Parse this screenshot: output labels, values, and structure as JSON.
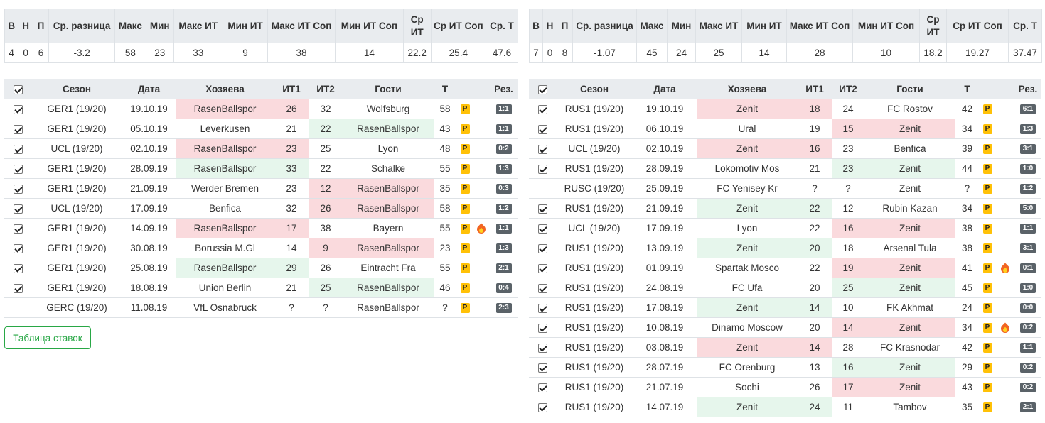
{
  "left": {
    "stats": {
      "headers": [
        "В",
        "Н",
        "П",
        "Ср. разница",
        "Макс",
        "Мин",
        "Макс ИТ",
        "Мин ИТ",
        "Макс ИТ Соп",
        "Мин ИТ Соп",
        "Ср ИТ",
        "Ср ИТ Соп",
        "Ср. Т"
      ],
      "values": [
        "4",
        "0",
        "6",
        "-3.2",
        "58",
        "23",
        "33",
        "9",
        "38",
        "14",
        "22.2",
        "25.4",
        "47.6"
      ]
    },
    "games": {
      "headers": [
        "Сезон",
        "Дата",
        "Хозяева",
        "ИТ1",
        "ИТ2",
        "Гости",
        "Т",
        "Рез."
      ],
      "rows": [
        {
          "checked": true,
          "season": "GER1 (19/20)",
          "date": "19.10.19",
          "home": "RasenBallspor",
          "it1": "26",
          "it2": "32",
          "away": "Wolfsburg",
          "t": "58",
          "fire": false,
          "res": "1:1",
          "hl": "home-lose"
        },
        {
          "checked": true,
          "season": "GER1 (19/20)",
          "date": "05.10.19",
          "home": "Leverkusen",
          "it1": "21",
          "it2": "22",
          "away": "RasenBallspor",
          "t": "43",
          "fire": false,
          "res": "1:1",
          "hl": "away-win"
        },
        {
          "checked": true,
          "season": "UCL (19/20)",
          "date": "02.10.19",
          "home": "RasenBallspor",
          "it1": "23",
          "it2": "25",
          "away": "Lyon",
          "t": "48",
          "fire": false,
          "res": "0:2",
          "hl": "home-lose"
        },
        {
          "checked": true,
          "season": "GER1 (19/20)",
          "date": "28.09.19",
          "home": "RasenBallspor",
          "it1": "33",
          "it2": "22",
          "away": "Schalke",
          "t": "55",
          "fire": false,
          "res": "1:3",
          "hl": "home-win"
        },
        {
          "checked": true,
          "season": "GER1 (19/20)",
          "date": "21.09.19",
          "home": "Werder Bremen",
          "it1": "23",
          "it2": "12",
          "away": "RasenBallspor",
          "t": "35",
          "fire": false,
          "res": "0:3",
          "hl": "away-lose"
        },
        {
          "checked": true,
          "season": "UCL (19/20)",
          "date": "17.09.19",
          "home": "Benfica",
          "it1": "32",
          "it2": "26",
          "away": "RasenBallspor",
          "t": "58",
          "fire": false,
          "res": "1:2",
          "hl": "away-lose"
        },
        {
          "checked": true,
          "season": "GER1 (19/20)",
          "date": "14.09.19",
          "home": "RasenBallspor",
          "it1": "17",
          "it2": "38",
          "away": "Bayern",
          "t": "55",
          "fire": true,
          "res": "1:1",
          "hl": "home-lose"
        },
        {
          "checked": true,
          "season": "GER1 (19/20)",
          "date": "30.08.19",
          "home": "Borussia M.Gl",
          "it1": "14",
          "it2": "9",
          "away": "RasenBallspor",
          "t": "23",
          "fire": false,
          "res": "1:3",
          "hl": "away-lose"
        },
        {
          "checked": true,
          "season": "GER1 (19/20)",
          "date": "25.08.19",
          "home": "RasenBallspor",
          "it1": "29",
          "it2": "26",
          "away": "Eintracht Fra",
          "t": "55",
          "fire": false,
          "res": "2:1",
          "hl": "home-win"
        },
        {
          "checked": true,
          "season": "GER1 (19/20)",
          "date": "18.08.19",
          "home": "Union Berlin",
          "it1": "21",
          "it2": "25",
          "away": "RasenBallspor",
          "t": "46",
          "fire": false,
          "res": "0:4",
          "hl": "away-win"
        },
        {
          "checked": false,
          "season": "GERC (19/20)",
          "date": "11.08.19",
          "home": "VfL Osnabruck",
          "it1": "?",
          "it2": "?",
          "away": "RasenBallspor",
          "t": "?",
          "fire": false,
          "res": "2:3",
          "hl": "none"
        }
      ]
    }
  },
  "right": {
    "stats": {
      "headers": [
        "В",
        "Н",
        "П",
        "Ср. разница",
        "Макс",
        "Мин",
        "Макс ИТ",
        "Мин ИТ",
        "Макс ИТ Соп",
        "Мин ИТ Соп",
        "Ср ИТ",
        "Ср ИТ Соп",
        "Ср. Т"
      ],
      "values": [
        "7",
        "0",
        "8",
        "-1.07",
        "45",
        "24",
        "25",
        "14",
        "28",
        "10",
        "18.2",
        "19.27",
        "37.47"
      ]
    },
    "games": {
      "headers": [
        "Сезон",
        "Дата",
        "Хозяева",
        "ИТ1",
        "ИТ2",
        "Гости",
        "Т",
        "Рез."
      ],
      "rows": [
        {
          "checked": true,
          "season": "RUS1 (19/20)",
          "date": "19.10.19",
          "home": "Zenit",
          "it1": "18",
          "it2": "24",
          "away": "FC Rostov",
          "t": "42",
          "fire": false,
          "res": "6:1",
          "hl": "home-lose"
        },
        {
          "checked": true,
          "season": "RUS1 (19/20)",
          "date": "06.10.19",
          "home": "Ural",
          "it1": "19",
          "it2": "15",
          "away": "Zenit",
          "t": "34",
          "fire": false,
          "res": "1:3",
          "hl": "away-lose"
        },
        {
          "checked": true,
          "season": "UCL (19/20)",
          "date": "02.10.19",
          "home": "Zenit",
          "it1": "16",
          "it2": "23",
          "away": "Benfica",
          "t": "39",
          "fire": false,
          "res": "3:1",
          "hl": "home-lose"
        },
        {
          "checked": true,
          "season": "RUS1 (19/20)",
          "date": "28.09.19",
          "home": "Lokomotiv Mos",
          "it1": "21",
          "it2": "23",
          "away": "Zenit",
          "t": "44",
          "fire": false,
          "res": "1:0",
          "hl": "away-win"
        },
        {
          "checked": false,
          "season": "RUSC (19/20)",
          "date": "25.09.19",
          "home": "FC Yenisey Kr",
          "it1": "?",
          "it2": "?",
          "away": "Zenit",
          "t": "?",
          "fire": false,
          "res": "1:2",
          "hl": "none"
        },
        {
          "checked": true,
          "season": "RUS1 (19/20)",
          "date": "21.09.19",
          "home": "Zenit",
          "it1": "22",
          "it2": "12",
          "away": "Rubin Kazan",
          "t": "34",
          "fire": false,
          "res": "5:0",
          "hl": "home-win"
        },
        {
          "checked": true,
          "season": "UCL (19/20)",
          "date": "17.09.19",
          "home": "Lyon",
          "it1": "22",
          "it2": "16",
          "away": "Zenit",
          "t": "38",
          "fire": false,
          "res": "1:1",
          "hl": "away-lose"
        },
        {
          "checked": true,
          "season": "RUS1 (19/20)",
          "date": "13.09.19",
          "home": "Zenit",
          "it1": "20",
          "it2": "18",
          "away": "Arsenal Tula",
          "t": "38",
          "fire": false,
          "res": "3:1",
          "hl": "home-win"
        },
        {
          "checked": true,
          "season": "RUS1 (19/20)",
          "date": "01.09.19",
          "home": "Spartak Mosco",
          "it1": "22",
          "it2": "19",
          "away": "Zenit",
          "t": "41",
          "fire": true,
          "res": "0:1",
          "hl": "away-lose"
        },
        {
          "checked": true,
          "season": "RUS1 (19/20)",
          "date": "24.08.19",
          "home": "FC Ufa",
          "it1": "20",
          "it2": "25",
          "away": "Zenit",
          "t": "45",
          "fire": false,
          "res": "1:0",
          "hl": "away-win"
        },
        {
          "checked": true,
          "season": "RUS1 (19/20)",
          "date": "17.08.19",
          "home": "Zenit",
          "it1": "14",
          "it2": "10",
          "away": "FK Akhmat",
          "t": "24",
          "fire": false,
          "res": "0:0",
          "hl": "home-win"
        },
        {
          "checked": true,
          "season": "RUS1 (19/20)",
          "date": "10.08.19",
          "home": "Dinamo Moscow",
          "it1": "20",
          "it2": "14",
          "away": "Zenit",
          "t": "34",
          "fire": true,
          "res": "0:2",
          "hl": "away-lose"
        },
        {
          "checked": true,
          "season": "RUS1 (19/20)",
          "date": "03.08.19",
          "home": "Zenit",
          "it1": "14",
          "it2": "28",
          "away": "FC Krasnodar",
          "t": "42",
          "fire": false,
          "res": "1:1",
          "hl": "home-lose"
        },
        {
          "checked": true,
          "season": "RUS1 (19/20)",
          "date": "28.07.19",
          "home": "FC Orenburg",
          "it1": "13",
          "it2": "16",
          "away": "Zenit",
          "t": "29",
          "fire": false,
          "res": "0:2",
          "hl": "away-win"
        },
        {
          "checked": true,
          "season": "RUS1 (19/20)",
          "date": "21.07.19",
          "home": "Sochi",
          "it1": "26",
          "it2": "17",
          "away": "Zenit",
          "t": "43",
          "fire": false,
          "res": "0:2",
          "hl": "away-lose"
        },
        {
          "checked": true,
          "season": "RUS1 (19/20)",
          "date": "14.07.19",
          "home": "Zenit",
          "it1": "24",
          "it2": "11",
          "away": "Tambov",
          "t": "35",
          "fire": false,
          "res": "2:1",
          "hl": "home-win"
        }
      ]
    }
  },
  "badge_label": "P",
  "bets_button_label": "Таблица ставок",
  "colors": {
    "win": "#e6f6ec",
    "lose": "#fadadd",
    "badge": "#ffc107",
    "result": "#5a6268",
    "button": "#28a745"
  },
  "icons": {
    "select_all": "checkbox-icon",
    "hot": "fire-icon"
  }
}
